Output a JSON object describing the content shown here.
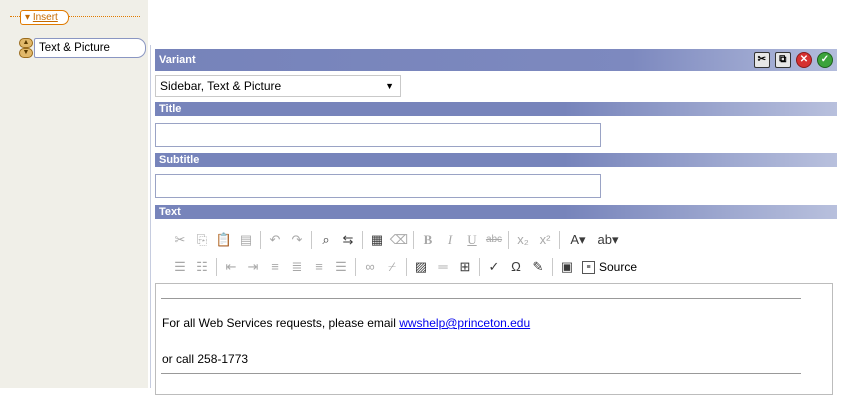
{
  "sidebar": {
    "insert_label": "Insert",
    "block_label": "Text & Picture"
  },
  "variant": {
    "label": "Variant",
    "selected": "Sidebar, Text & Picture",
    "controls": [
      "cut-icon",
      "copy-icon",
      "delete-icon",
      "confirm-icon"
    ]
  },
  "fields": {
    "title_label": "Title",
    "title_value": "",
    "subtitle_label": "Subtitle",
    "subtitle_value": "",
    "text_label": "Text"
  },
  "toolbar": {
    "source_label": "Source"
  },
  "editor": {
    "line1_text": "For all Web Services requests, please email ",
    "line1_link": "wwshelp@princeton.edu",
    "line2_text": "or call 258-1773"
  }
}
